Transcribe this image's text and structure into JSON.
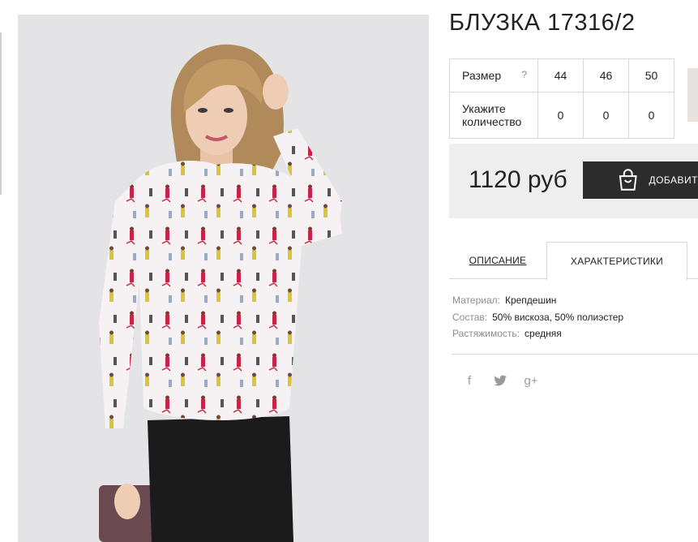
{
  "product": {
    "title": "БЛУЗКА 17316/2",
    "price": "1120 руб",
    "add_to_cart_label": "ДОБАВИТ"
  },
  "size_table": {
    "size_label": "Размер",
    "help_icon": "?",
    "sizes": [
      "44",
      "46",
      "50"
    ],
    "quantity_label_line1": "Укажите",
    "quantity_label_line2": "количество",
    "quantities": [
      "0",
      "0",
      "0"
    ]
  },
  "tabs": {
    "description": "ОПИСАНИЕ",
    "characteristics": "ХАРАКТЕРИСТИКИ",
    "active": "characteristics"
  },
  "characteristics": [
    {
      "key": "Материал:",
      "value": "Крепдешин"
    },
    {
      "key": "Состав:",
      "value": "50% вискоза, 50% полиэстер"
    },
    {
      "key": "Растяжимость:",
      "value": "средняя"
    }
  ],
  "social": {
    "facebook": "f",
    "twitter": "twitter-icon",
    "googleplus": "g+"
  },
  "colors": {
    "button_bg": "#2c2c2c",
    "price_bar_bg": "#eeeeee",
    "border": "#d9d9d9"
  }
}
